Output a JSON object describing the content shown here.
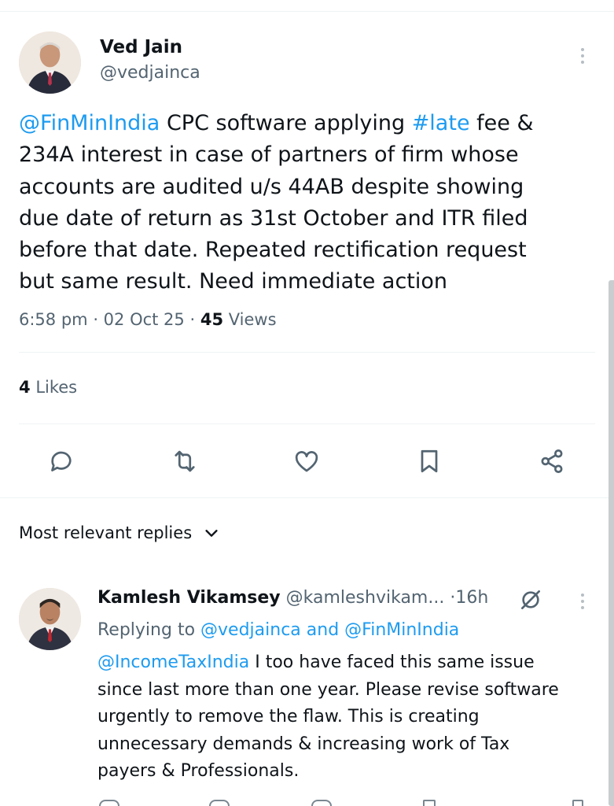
{
  "tweet": {
    "author_name": "Ved Jain",
    "author_handle": "@vedjainca",
    "text_parts": [
      {
        "t": "@FinMinIndia",
        "link": true
      },
      {
        "t": " CPC software applying ",
        "link": false
      },
      {
        "t": "#late",
        "link": true
      },
      {
        "t": " fee & \n234A interest  in case of partners of firm whose \naccounts are audited u/s 44AB despite showing \ndue date of return as 31st October and ITR filed \nbefore that date. Repeated rectification request \nbut same result. Need immediate action",
        "link": false
      }
    ],
    "time": "6:58 pm",
    "date": "02 Oct 25",
    "views_count": "45",
    "views_label": "Views",
    "likes_count": "4",
    "likes_label": "Likes"
  },
  "actions": [
    "reply-icon",
    "retweet-icon",
    "like-icon",
    "bookmark-icon",
    "share-icon"
  ],
  "replies_sort": {
    "label": "Most relevant replies"
  },
  "reply": {
    "author_name": "Kamlesh Vikamsey",
    "author_handle": "@kamleshvikam...",
    "time": "16h",
    "replying_prefix": "Replying to",
    "replying_to": "@vedjainca and @FinMinIndia",
    "mention": "@IncomeTaxIndia",
    "text": " I too have faced this same issue \nsince last more than one year. Please revise software \nurgently to remove the flaw. This is creating \nunnecessary demands & increasing work of Tax \npayers & Professionals."
  },
  "colors": {
    "link": "#1d9bf0",
    "secondary": "#536471",
    "icon": "#536471"
  }
}
